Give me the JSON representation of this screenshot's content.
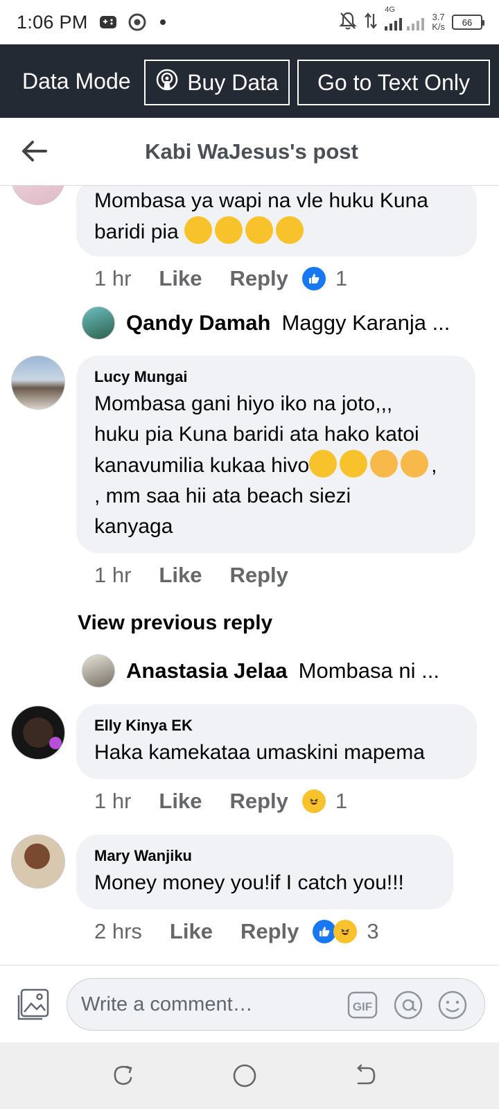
{
  "status_bar": {
    "time": "1:06 PM",
    "network": "4G",
    "speed_value": "3.7",
    "speed_unit": "K/s",
    "battery": "66"
  },
  "data_bar": {
    "mode_label": "Data Mode",
    "buy_label": "Buy Data",
    "text_only_label": "Go to Text Only"
  },
  "header": {
    "title": "Kabi WaJesus's post"
  },
  "comments": [
    {
      "text": "Mombasa ya wapi na vle huku Kuna baridi pia",
      "time": "1 hr",
      "like": "Like",
      "reply": "Reply",
      "reaction_count": "1",
      "reply_preview": {
        "name": "Qandy Damah",
        "snippet": "Maggy Karanja ..."
      }
    },
    {
      "name": "Lucy Mungai",
      "text_lines": [
        "Mombasa gani hiyo iko na joto,,,",
        "huku pia Kuna baridi ata hako katoi",
        "kanavumilia kukaa hivo",
        ", mm saa hii ata beach siezi",
        "kanyaga"
      ],
      "time": "1 hr",
      "like": "Like",
      "reply": "Reply",
      "view_previous": "View previous reply",
      "reply_preview": {
        "name": "Anastasia Jelaa",
        "snippet": "Mombasa ni ..."
      }
    },
    {
      "name": "Elly Kinya EK",
      "text": "Haka kamekataa umaskini mapema",
      "time": "1 hr",
      "like": "Like",
      "reply": "Reply",
      "reaction_count": "1"
    },
    {
      "name": "Mary Wanjiku",
      "text": "Money money you!if I catch you!!!",
      "time": "2 hrs",
      "like": "Like",
      "reply": "Reply",
      "reaction_count": "3"
    }
  ],
  "composer": {
    "placeholder": "Write a comment…"
  }
}
